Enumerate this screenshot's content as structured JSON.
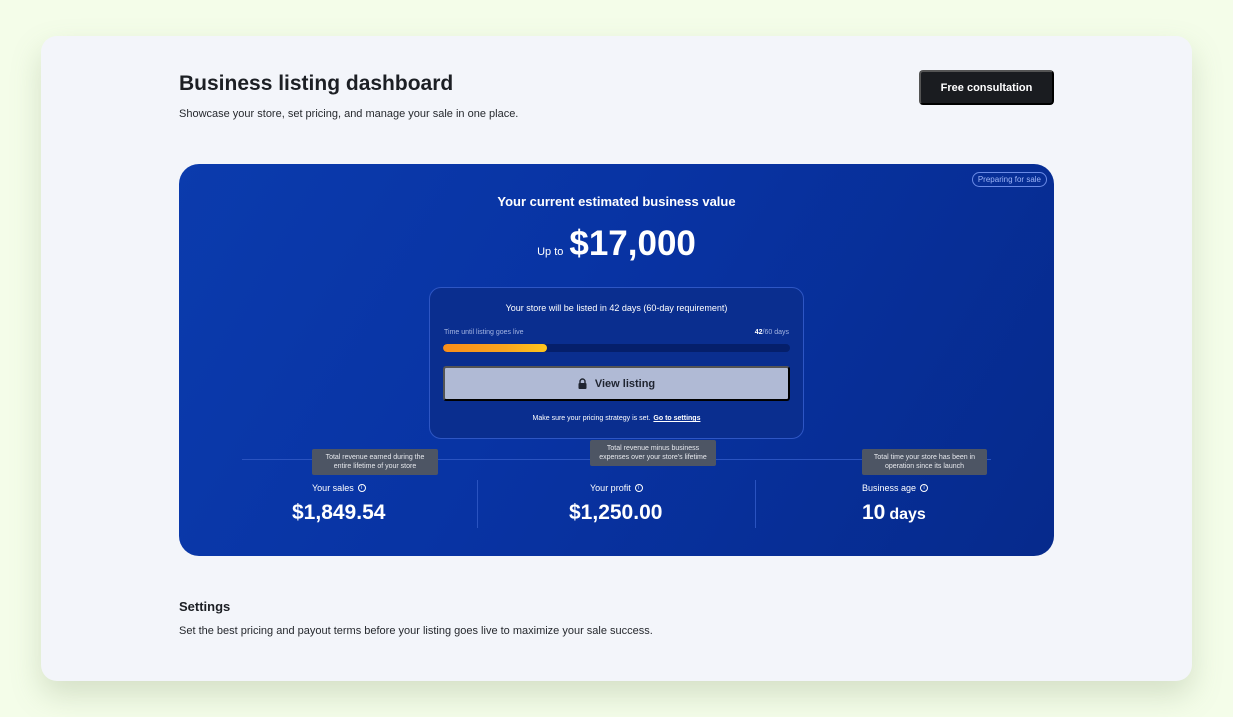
{
  "header": {
    "title": "Business listing dashboard",
    "subtitle": "Showcase your store, set pricing, and manage your sale in one place.",
    "consult_button": "Free consultation"
  },
  "hero": {
    "badge": "Preparing for sale",
    "heading": "Your current estimated business value",
    "value_prefix": "Up to",
    "value": "$17,000",
    "listing": {
      "message": "Your store will be listed in 42 days (60-day requirement)",
      "progress_label": "Time until listing goes live",
      "progress_current": "42",
      "progress_total": "/60 days",
      "progress_fraction": 0.3,
      "button_label": "View listing",
      "hint_text": "Make sure your pricing strategy is set.",
      "hint_link": "Go to settings"
    },
    "stats": [
      {
        "label": "Your sales",
        "value": "$1,849.54",
        "tooltip": "Total revenue earned during the entire lifetime of your store"
      },
      {
        "label": "Your profit",
        "value": "$1,250.00",
        "tooltip": "Total revenue minus business expenses over your store's lifetime"
      },
      {
        "label": "Business age",
        "value": "10",
        "unit": "days",
        "tooltip": "Total time your store has been in operation since its launch"
      }
    ]
  },
  "settings": {
    "title": "Settings",
    "description": "Set the best pricing and payout terms before your listing goes live to maximize your sale success."
  },
  "colors": {
    "hero_bg": "#0a36a6",
    "progress_fill": "#f9a51f",
    "primary_button": "#1a1c20"
  },
  "icons": {
    "lock": "lock-icon",
    "info": "info-icon"
  }
}
